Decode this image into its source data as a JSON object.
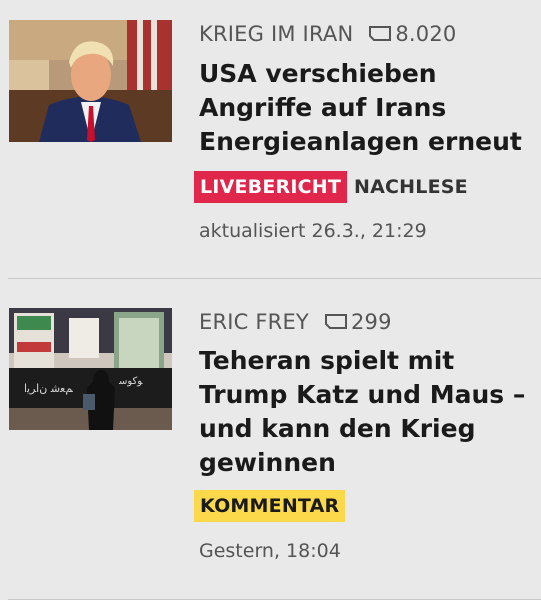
{
  "articles": [
    {
      "category": "KRIEG IM IRAN",
      "comment_count": "8.020",
      "headline": "USA verschieben Angriffe auf Irans Energieanlagen erneut",
      "tags": [
        "LIVEBERICHT",
        "NACHLESE"
      ],
      "timestamp": "aktualisiert 26.3., 21:29",
      "icon": "comment-icon"
    },
    {
      "category": "ERIC FREY",
      "comment_count": "299",
      "headline": "Teheran spielt mit Trump Katz und Maus – und kann den Krieg gewinnen",
      "tags": [
        "KOMMENTAR"
      ],
      "timestamp": "Gestern, 18:04",
      "icon": "comment-icon"
    }
  ],
  "colors": {
    "live_tag": "#e0264a",
    "comment_tag": "#fbd94a",
    "background": "#e9e9e9"
  }
}
